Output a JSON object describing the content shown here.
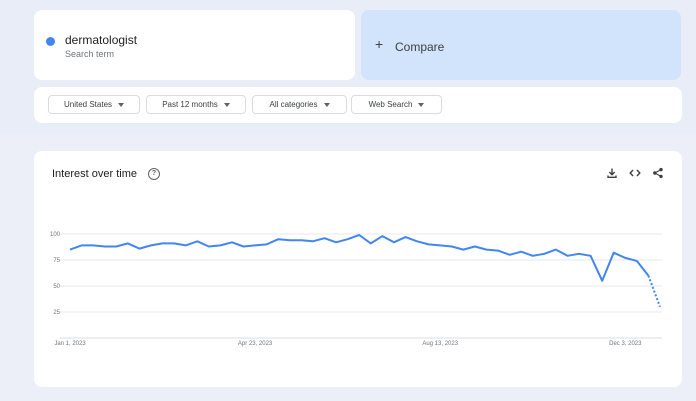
{
  "search_term": {
    "name": "dermatologist",
    "sub": "Search term",
    "color": "#4285f4"
  },
  "compare": {
    "plus": "+",
    "label": "Compare"
  },
  "filters": [
    {
      "label": "United States"
    },
    {
      "label": "Past 12 months"
    },
    {
      "label": "All categories"
    },
    {
      "label": "Web Search"
    }
  ],
  "chart": {
    "title": "Interest over time",
    "help_icon": "help-icon",
    "actions": [
      "download-icon",
      "embed-code-icon",
      "share-icon"
    ]
  },
  "chart_data": {
    "type": "line",
    "ylim": [
      0,
      100
    ],
    "yticks": [
      25,
      50,
      75,
      100
    ],
    "xticks": [
      {
        "label": "Jan 1, 2023",
        "index": 0
      },
      {
        "label": "Apr 23, 2023",
        "index": 16
      },
      {
        "label": "Aug 13, 2023",
        "index": 32
      },
      {
        "label": "Dec 3, 2023",
        "index": 48
      }
    ],
    "grid": true,
    "series": [
      {
        "color": "#4285f4",
        "values": [
          85,
          89,
          89,
          88,
          88,
          91,
          86,
          89,
          91,
          91,
          89,
          93,
          88,
          89,
          92,
          88,
          89,
          90,
          95,
          94,
          94,
          93,
          96,
          92,
          95,
          99,
          91,
          98,
          92,
          97,
          93,
          90,
          89,
          88,
          85,
          88,
          85,
          84,
          80,
          83,
          79,
          81,
          85,
          79,
          81,
          79,
          55,
          82,
          77,
          74,
          60,
          30
        ],
        "partial_from_index": 50
      }
    ]
  }
}
